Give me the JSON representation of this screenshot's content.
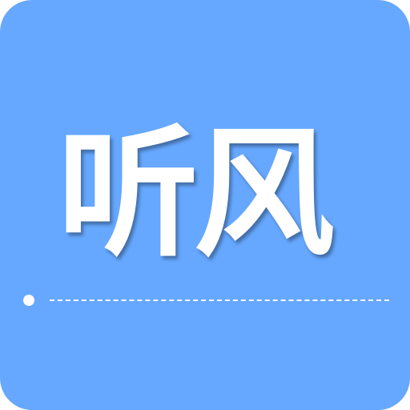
{
  "app_icon": {
    "title": "听风",
    "background_color": "#66a8ff",
    "text_color": "#ffffff",
    "divider": {
      "dot_icon": "dot-icon",
      "line_style": "dashed"
    }
  }
}
